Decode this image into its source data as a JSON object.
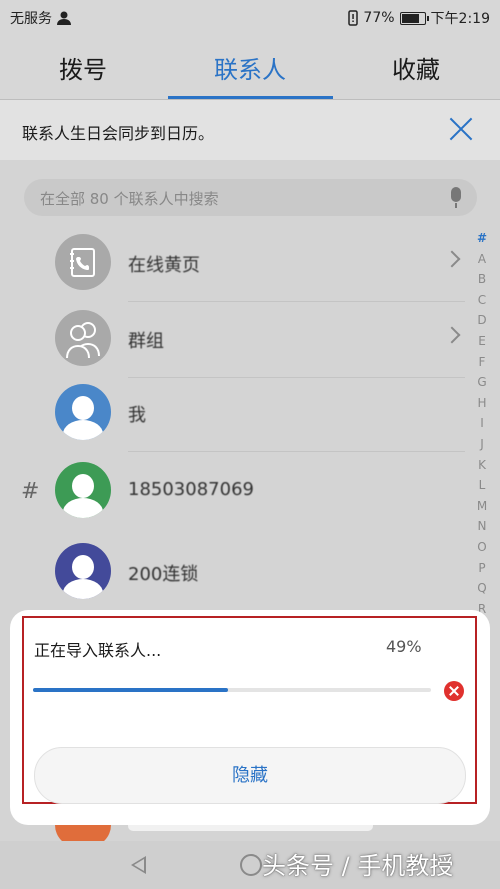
{
  "status_bar": {
    "carrier": "无服务",
    "battery_percent": "77%",
    "time": "下午2:19",
    "icons": [
      "person-icon",
      "battery-alert-icon",
      "battery-icon"
    ]
  },
  "tabs": [
    {
      "label": "拨号",
      "active": false
    },
    {
      "label": "联系人",
      "active": true
    },
    {
      "label": "收藏",
      "active": false
    }
  ],
  "notice": {
    "text": "联系人生日会同步到日历。",
    "close_icon": "close-icon"
  },
  "search": {
    "placeholder": "在全部 80 个联系人中搜索",
    "icon": "microphone-icon"
  },
  "contacts": [
    {
      "name": "在线黄页",
      "avatar_color": "#a9a9a9",
      "avatar_icon": "phonebook-icon",
      "has_chevron": true
    },
    {
      "name": "群组",
      "avatar_color": "#a9a9a9",
      "avatar_icon": "group-icon",
      "has_chevron": true
    },
    {
      "name": "我",
      "avatar_color": "#4a87c9",
      "avatar_icon": "person-icon",
      "has_chevron": false
    },
    {
      "name": "18503087069",
      "avatar_color": "#3d9b55",
      "avatar_icon": "person-icon",
      "has_chevron": false
    },
    {
      "name": "200连锁",
      "avatar_color": "#434a9a",
      "avatar_icon": "person-icon",
      "has_chevron": false
    }
  ],
  "section_label": "#",
  "index_letters": [
    "#",
    "A",
    "B",
    "C",
    "D",
    "E",
    "F",
    "G",
    "H",
    "I",
    "J",
    "K",
    "L",
    "M",
    "N",
    "O",
    "P",
    "Q",
    "R"
  ],
  "import_dialog": {
    "title": "正在导入联系人...",
    "percent_text": "49%",
    "progress": 0.49,
    "hide_label": "隐藏",
    "cancel_icon": "cancel-icon"
  },
  "watermark": "头条号 / 手机教授",
  "colors": {
    "accent": "#2a73c6",
    "cancel": "#e0312e",
    "highlight_box": "#b72124"
  }
}
